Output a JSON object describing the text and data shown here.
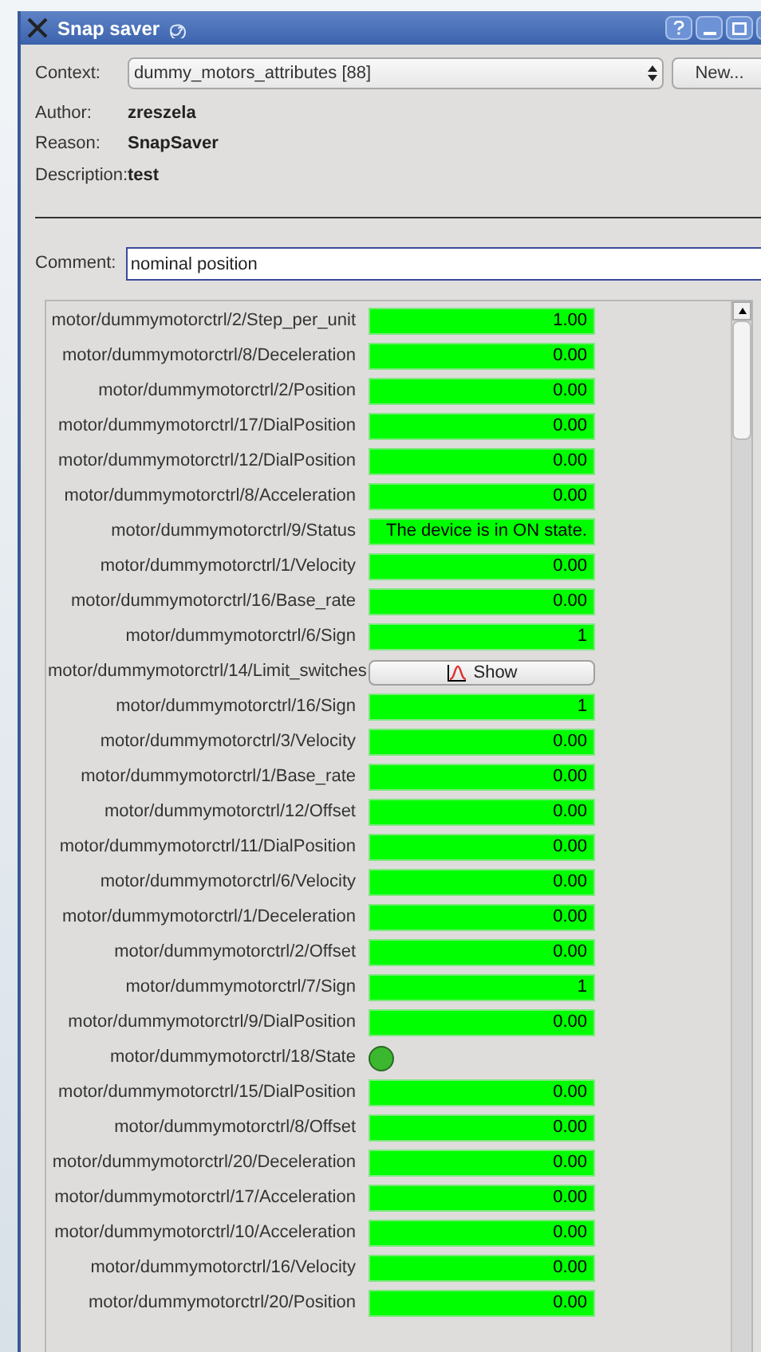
{
  "window": {
    "title": "Snap saver"
  },
  "context": {
    "label": "Context:",
    "value": "dummy_motors_attributes [88]",
    "new_button": "New..."
  },
  "info": [
    {
      "label": "Author:",
      "value": "zreszela"
    },
    {
      "label": "Reason:",
      "value": "SnapSaver"
    },
    {
      "label": "Description:",
      "value": "test"
    }
  ],
  "comment": {
    "label": "Comment:",
    "value": "nominal position"
  },
  "attributes": [
    {
      "name": "motor/dummymotorctrl/2/Step_per_unit",
      "kind": "value",
      "value": "1.00"
    },
    {
      "name": "motor/dummymotorctrl/8/Deceleration",
      "kind": "value",
      "value": "0.00"
    },
    {
      "name": "motor/dummymotorctrl/2/Position",
      "kind": "value",
      "value": "0.00"
    },
    {
      "name": "motor/dummymotorctrl/17/DialPosition",
      "kind": "value",
      "value": "0.00"
    },
    {
      "name": "motor/dummymotorctrl/12/DialPosition",
      "kind": "value",
      "value": "0.00"
    },
    {
      "name": "motor/dummymotorctrl/8/Acceleration",
      "kind": "value",
      "value": "0.00"
    },
    {
      "name": "motor/dummymotorctrl/9/Status",
      "kind": "value",
      "value": "The device is in ON state."
    },
    {
      "name": "motor/dummymotorctrl/1/Velocity",
      "kind": "value",
      "value": "0.00"
    },
    {
      "name": "motor/dummymotorctrl/16/Base_rate",
      "kind": "value",
      "value": "0.00"
    },
    {
      "name": "motor/dummymotorctrl/6/Sign",
      "kind": "value",
      "value": "1"
    },
    {
      "name": "motor/dummymotorctrl/14/Limit_switches",
      "kind": "button",
      "value": "Show"
    },
    {
      "name": "motor/dummymotorctrl/16/Sign",
      "kind": "value",
      "value": "1"
    },
    {
      "name": "motor/dummymotorctrl/3/Velocity",
      "kind": "value",
      "value": "0.00"
    },
    {
      "name": "motor/dummymotorctrl/1/Base_rate",
      "kind": "value",
      "value": "0.00"
    },
    {
      "name": "motor/dummymotorctrl/12/Offset",
      "kind": "value",
      "value": "0.00"
    },
    {
      "name": "motor/dummymotorctrl/11/DialPosition",
      "kind": "value",
      "value": "0.00"
    },
    {
      "name": "motor/dummymotorctrl/6/Velocity",
      "kind": "value",
      "value": "0.00"
    },
    {
      "name": "motor/dummymotorctrl/1/Deceleration",
      "kind": "value",
      "value": "0.00"
    },
    {
      "name": "motor/dummymotorctrl/2/Offset",
      "kind": "value",
      "value": "0.00"
    },
    {
      "name": "motor/dummymotorctrl/7/Sign",
      "kind": "value",
      "value": "1"
    },
    {
      "name": "motor/dummymotorctrl/9/DialPosition",
      "kind": "value",
      "value": "0.00"
    },
    {
      "name": "motor/dummymotorctrl/18/State",
      "kind": "led",
      "color": "#3cb830"
    },
    {
      "name": "motor/dummymotorctrl/15/DialPosition",
      "kind": "value",
      "value": "0.00"
    },
    {
      "name": "motor/dummymotorctrl/8/Offset",
      "kind": "value",
      "value": "0.00"
    },
    {
      "name": "motor/dummymotorctrl/20/Deceleration",
      "kind": "value",
      "value": "0.00"
    },
    {
      "name": "motor/dummymotorctrl/17/Acceleration",
      "kind": "value",
      "value": "0.00"
    },
    {
      "name": "motor/dummymotorctrl/10/Acceleration",
      "kind": "value",
      "value": "0.00"
    },
    {
      "name": "motor/dummymotorctrl/16/Velocity",
      "kind": "value",
      "value": "0.00"
    },
    {
      "name": "motor/dummymotorctrl/20/Position",
      "kind": "value",
      "value": "0.00"
    }
  ]
}
